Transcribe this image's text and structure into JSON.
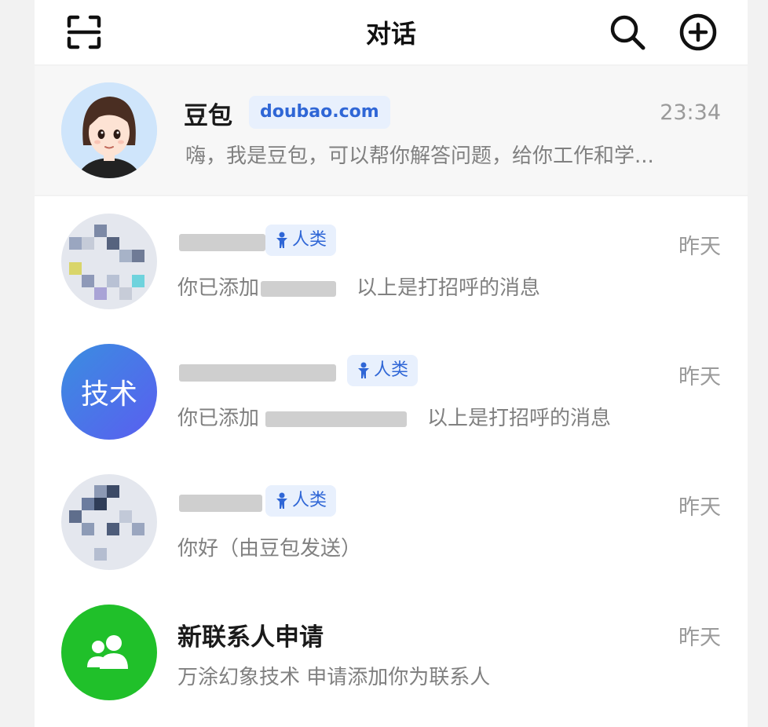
{
  "header": {
    "title": "对话",
    "icons": [
      "scan-icon",
      "search-icon",
      "add-circle-icon"
    ]
  },
  "pinned": {
    "name": "豆包",
    "badge": "doubao.com",
    "time": "23:34",
    "preview": "嗨，我是豆包，可以帮你解答问题，给你工作和学..."
  },
  "conversations": [
    {
      "tag": "人类",
      "time": "昨天",
      "preview_prefix": "你已添加",
      "preview_suffix": "以上是打招呼的消息"
    },
    {
      "avatar_text": "技术",
      "avatar_color": "#3f7de8",
      "tag": "人类",
      "time": "昨天",
      "preview_prefix": "你已添加",
      "preview_suffix": "以上是打招呼的消息"
    },
    {
      "tag": "人类",
      "time": "昨天",
      "preview": "你好（由豆包发送）"
    },
    {
      "name": "新联系人申请",
      "time": "昨天",
      "preview": "万涂幻象技术 申请添加你为联系人",
      "avatar_color": "#20c02a",
      "avatar_icon": "contacts-icon"
    }
  ],
  "colors": {
    "accent": "#2f66d6",
    "tag_bg": "#e8f0fd",
    "green": "#20c02a",
    "blue_avatar": "#3f7de8"
  }
}
